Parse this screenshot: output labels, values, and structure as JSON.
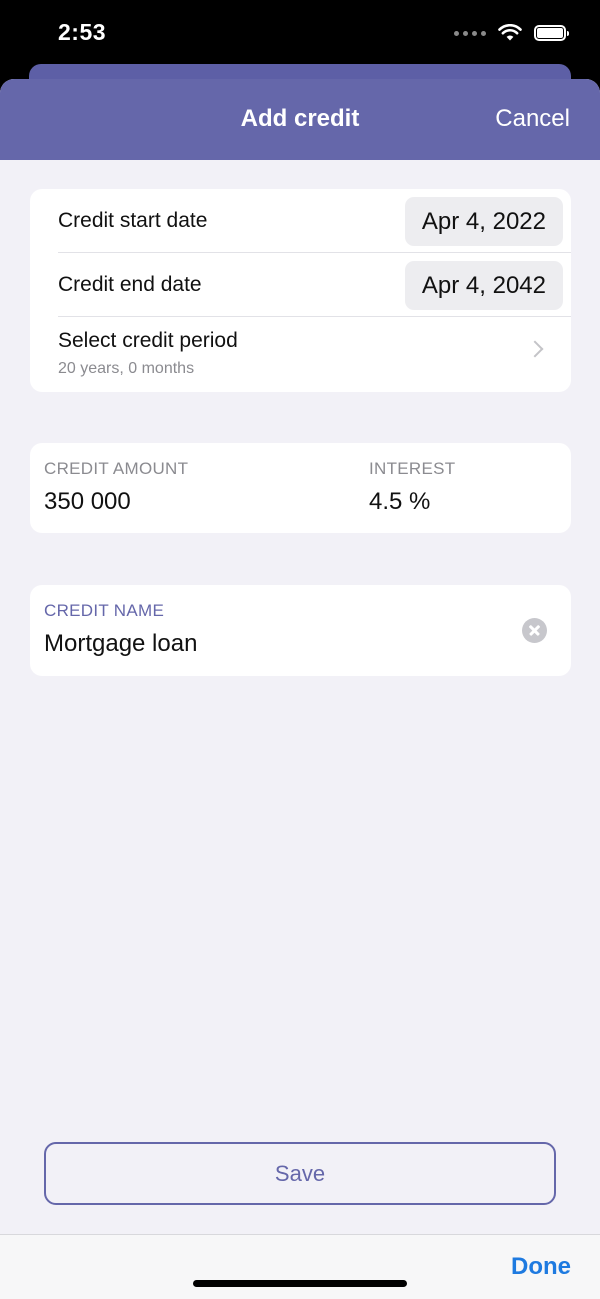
{
  "status_bar": {
    "time": "2:53",
    "icons": [
      "signal-dots-icon",
      "wifi-icon",
      "battery-icon"
    ]
  },
  "nav": {
    "title": "Add credit",
    "cancel_label": "Cancel"
  },
  "dates": {
    "start_label": "Credit start date",
    "start_value": "Apr 4, 2022",
    "end_label": "Credit end date",
    "end_value": "Apr 4, 2042",
    "period_label": "Select credit period",
    "period_value": "20 years, 0 months"
  },
  "amount": {
    "amount_label": "CREDIT AMOUNT",
    "amount_value": "350 000",
    "interest_label": "INTEREST",
    "interest_value": "4.5 %"
  },
  "name": {
    "label": "CREDIT NAME",
    "value": "Mortgage loan"
  },
  "save_label": "Save",
  "toolbar": {
    "done_label": "Done"
  },
  "colors": {
    "accent": "#6567aa",
    "background": "#f2f1f7",
    "link": "#1e7ae0"
  }
}
